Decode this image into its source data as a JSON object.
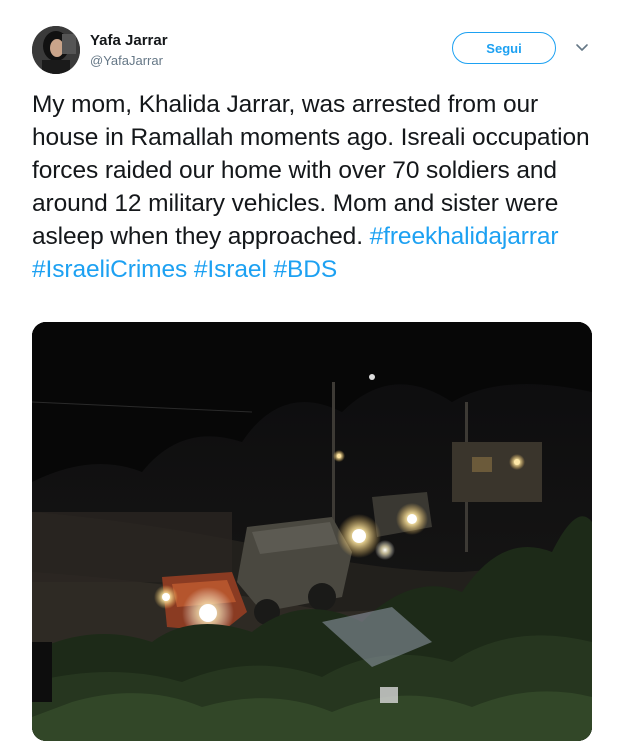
{
  "author": {
    "name": "Yafa Jarrar",
    "handle": "@YafaJarrar"
  },
  "actions": {
    "follow_label": "Segui"
  },
  "tweet": {
    "text": "My mom, Khalida Jarrar, was arrested from our house in Ramallah moments ago. Isreali occupation forces raided our home with over 70 soldiers and around 12 military vehicles. Mom and sister were asleep when they approached.",
    "hashtags": [
      "#freekhalidajarrar",
      "#IsraeliCrimes",
      "#Israel",
      "#BDS"
    ]
  },
  "colors": {
    "link": "#1da1f2",
    "text": "#14171a",
    "muted": "#657786"
  },
  "icons": {
    "menu": "chevron-down-icon"
  }
}
